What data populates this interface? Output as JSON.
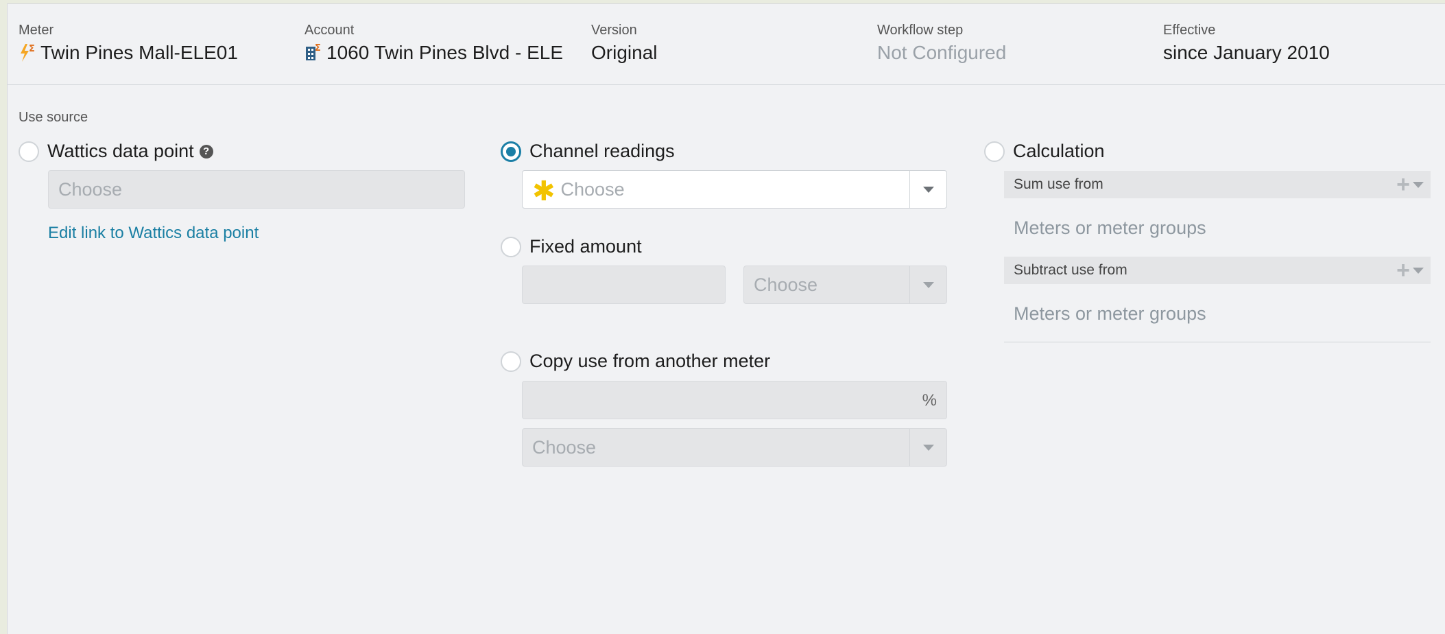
{
  "header": {
    "meter": {
      "label": "Meter",
      "value": "Twin Pines Mall-ELE01",
      "icon": "electric-meter-calc-icon"
    },
    "account": {
      "label": "Account",
      "value": "1060 Twin Pines Blvd - ELE",
      "icon": "account-building-calc-icon"
    },
    "version": {
      "label": "Version",
      "value": "Original"
    },
    "workflow": {
      "label": "Workflow step",
      "value": "Not Configured"
    },
    "effective": {
      "label": "Effective",
      "value": "since January 2010"
    }
  },
  "use_source": {
    "label": "Use source",
    "selected": "channel_readings",
    "wattics": {
      "label": "Wattics data point",
      "help_icon": "help-circle-icon",
      "placeholder": "Choose",
      "link": "Edit link to Wattics data point"
    },
    "channel_readings": {
      "label": "Channel readings",
      "placeholder": "Choose",
      "required_icon": "asterisk-icon"
    },
    "fixed_amount": {
      "label": "Fixed amount",
      "amount_value": "",
      "unit_placeholder": "Choose"
    },
    "copy_use": {
      "label": "Copy use from another meter",
      "percent_value": "",
      "percent_suffix": "%",
      "meter_placeholder": "Choose"
    },
    "calculation": {
      "label": "Calculation",
      "sum": {
        "title": "Sum use from",
        "placeholder": "Meters or meter groups"
      },
      "subtract": {
        "title": "Subtract use from",
        "placeholder": "Meters or meter groups"
      }
    }
  },
  "colors": {
    "accent": "#1b7fa6",
    "link": "#1a7fa3",
    "required": "#f2c300",
    "meter_icon": "#f5a623"
  }
}
